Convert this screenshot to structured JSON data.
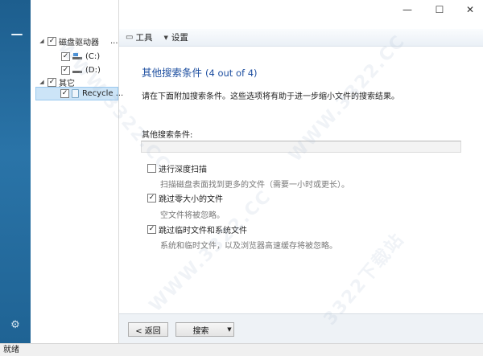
{
  "window": {
    "minimize": "—",
    "maximize": "☐",
    "close": "✕"
  },
  "toolbar": {
    "tools_label": "工具",
    "settings_label": "设置"
  },
  "tree": {
    "drives_label": "磁盘驱动器",
    "drives_more": "...",
    "drive_c": "(C:)",
    "drive_d": "(D:)",
    "other_label": "其它",
    "recycle": "Recycle ..."
  },
  "content": {
    "title": "其他搜索条件",
    "step": "(4 out of 4)",
    "description": "请在下面附加搜索条件。这些选项将有助于进一步缩小文件的搜索结果。",
    "field_label": "其他搜索条件:",
    "options": [
      {
        "label": "进行深度扫描",
        "desc": "扫描磁盘表面找到更多的文件（需要一小时或更长）。",
        "checked": false
      },
      {
        "label": "跳过零大小的文件",
        "desc": "空文件将被忽略。",
        "checked": true
      },
      {
        "label": "跳过临时文件和系统文件",
        "desc": "系统和临时文件，以及浏览器高速缓存将被忽略。",
        "checked": true
      }
    ]
  },
  "footer": {
    "back_label": "< 返回",
    "search_label": "搜索",
    "dropdown_arrow": "▼"
  },
  "status": {
    "text": "就绪"
  },
  "watermark": {
    "text": "WWW.3322.CC",
    "cn": "3322下载站"
  },
  "colors": {
    "accent": "#1e4fa0",
    "sidebar": "#2a74a8"
  }
}
